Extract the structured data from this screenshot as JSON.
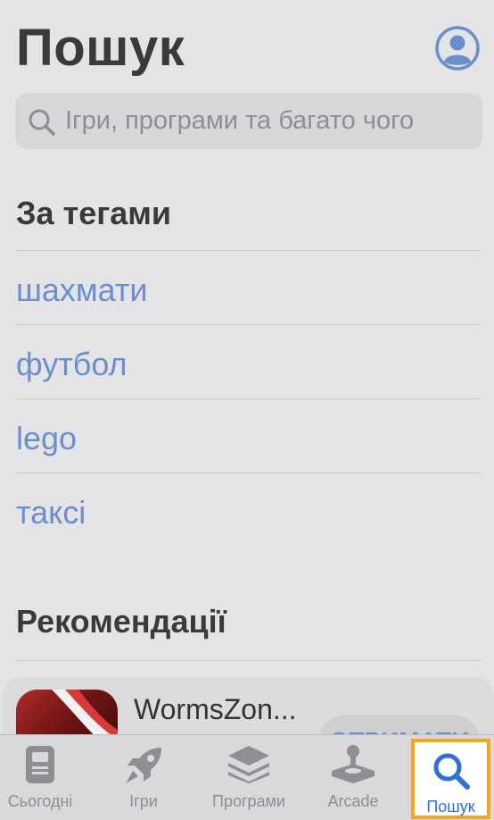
{
  "header": {
    "title": "Пошук"
  },
  "search": {
    "placeholder": "Ігри, програми та багато чого"
  },
  "tags_section": {
    "title": "За тегами",
    "items": [
      "шахмати",
      "футбол",
      "lego",
      "таксі"
    ]
  },
  "recommendations": {
    "title": "Рекомендації",
    "app": {
      "name": "WormsZon...",
      "button_label": "ОТРИМАТИ"
    }
  },
  "tab_bar": {
    "tabs": [
      {
        "label": "Сьогодні",
        "icon": "today-icon"
      },
      {
        "label": "Ігри",
        "icon": "rocket-icon"
      },
      {
        "label": "Програми",
        "icon": "layers-icon"
      },
      {
        "label": "Arcade",
        "icon": "joystick-icon"
      },
      {
        "label": "Пошук",
        "icon": "search-icon",
        "active": true
      }
    ]
  },
  "colors": {
    "accent": "#2f6fd6",
    "link": "#6a8fcf",
    "highlight": "#f2a81d"
  }
}
